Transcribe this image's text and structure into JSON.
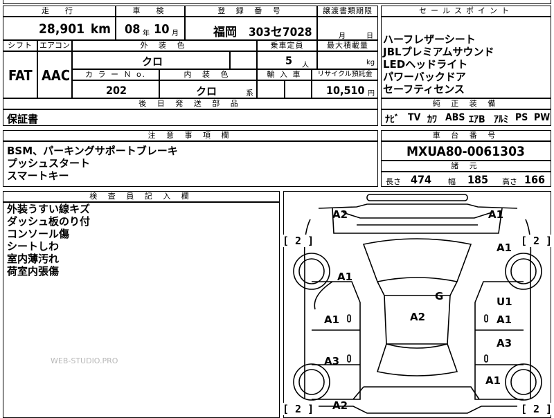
{
  "top": {
    "labels": {
      "mileage": "走　行",
      "inspection": "車　検",
      "registration": "登 録 番 号",
      "transfer": "譲渡書類期限",
      "shift": "シフト",
      "aircon": "エアコン",
      "exterior_color": "外 装 色",
      "capacity": "乗車定員",
      "max_load": "最大積載量",
      "color_no": "カ ラ ー Ｎ o.",
      "interior_color": "内 装 色",
      "import": "輸 入 車",
      "recycle": "リサイクル預託金"
    },
    "mileage_value": "28,901",
    "mileage_unit": "km",
    "inspection_year": "08",
    "inspection_year_unit": "年",
    "inspection_month": "10",
    "inspection_month_unit": "月",
    "registration_value": "福岡　303セ7028",
    "transfer_month_unit": "月",
    "transfer_day_unit": "日",
    "shift_value": "FAT",
    "aircon_value": "AAC",
    "exterior_color_value": "クロ",
    "capacity_value": "5",
    "capacity_unit": "人",
    "max_load_unit": "kg",
    "color_no_value": "202",
    "interior_color_value": "クロ",
    "interior_color_suffix": "系",
    "recycle_value": "10,510",
    "recycle_unit": "円"
  },
  "sales_points": {
    "header": "セールスポイント",
    "items": [
      "ハーフレザーシート",
      "JBLプレミアムサウンド",
      "LEDヘッドライト",
      "パワーバックドア",
      "セーフティセンス"
    ]
  },
  "later_parts": {
    "header": "後 日 発 送 部 品",
    "value": "保証書"
  },
  "standard_equipment": {
    "header": "純 正 装 備",
    "items": [
      "ﾅﾋﾞ",
      "TV",
      "ｶﾜ",
      "ABS",
      "ｴｱB",
      "ｱﾙﾐ",
      "PS",
      "PW"
    ]
  },
  "notes": {
    "header": "注 意 事 項 欄",
    "lines": [
      "BSM、パーキングサポートブレーキ",
      "プッシュスタート",
      "スマートキー"
    ]
  },
  "chassis": {
    "header": "車 台 番 号",
    "value": "MXUA80-0061303"
  },
  "specs": {
    "header": "諸 元",
    "length_label": "長さ",
    "length_value": "474",
    "width_label": "幅",
    "width_value": "185",
    "height_label": "高さ",
    "height_value": "166"
  },
  "inspector": {
    "header": "検 査 員 記 入 欄",
    "lines": [
      "外装うすい線キズ",
      "ダッシュ板のり付",
      "コンソール傷",
      "シートしわ",
      "室内薄汚れ",
      "荷室内張傷"
    ]
  },
  "watermark": "WEB-STUDIO.PRO",
  "diagram": {
    "marks": {
      "front_left": "A2",
      "front_right": "A1",
      "fender_left": "A1",
      "fender_right": "A1",
      "door_front_left": "A1",
      "door_front_right_top": "U1",
      "door_front_right": "A1",
      "door_rear_left": "A3",
      "door_rear_right": "A3",
      "glass": "G",
      "roof": "A2",
      "quarter_right": "A1",
      "rear_left": "A2"
    },
    "bracket_left_top": "[ 2 ]",
    "bracket_right_top": "[ 2 ]",
    "bracket_left_bottom": "[ 2 ]",
    "bracket_right_bottom": "[ 2 ]"
  }
}
